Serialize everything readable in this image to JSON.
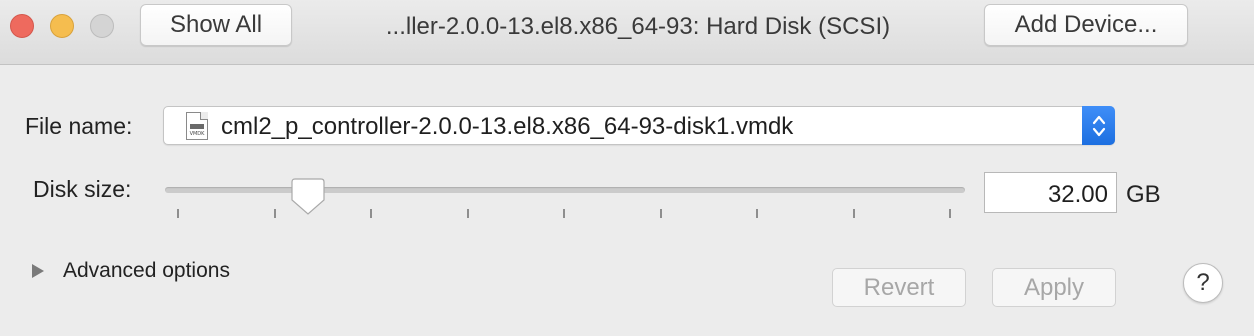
{
  "window": {
    "title": "...ller-2.0.0-13.el8.x86_64-93: Hard Disk (SCSI)",
    "show_all_label": "Show All",
    "add_device_label": "Add Device..."
  },
  "file": {
    "label": "File name:",
    "value": "cml2_p_controller-2.0.0-13.el8.x86_64-93-disk1.vmdk",
    "icon": "vmdk-file-icon",
    "icon_text": "VMDK"
  },
  "disk_size": {
    "label": "Disk size:",
    "value": "32.00",
    "unit": "GB",
    "slider_fraction": 0.17,
    "tick_count": 9
  },
  "advanced": {
    "label": "Advanced options",
    "expanded": false
  },
  "actions": {
    "revert_label": "Revert",
    "apply_label": "Apply",
    "help_label": "?"
  },
  "colors": {
    "accent": "#1d6fe0",
    "close": "#ee6a5e",
    "minimize": "#f5bd4f",
    "zoom_inactive": "#d4d4d4"
  }
}
